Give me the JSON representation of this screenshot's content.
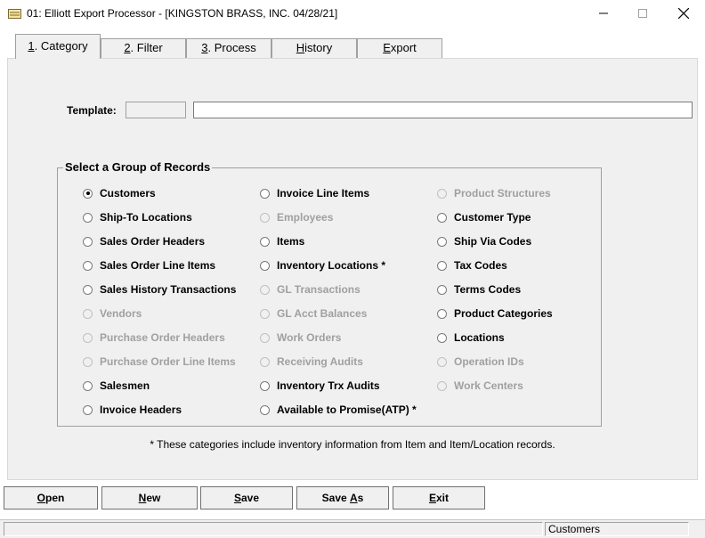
{
  "window": {
    "title": "01: Elliott Export Processor - [KINGSTON BRASS, INC. 04/28/21]",
    "icon": "folder-icon"
  },
  "tabs": [
    {
      "mnemonic": "1",
      "rest": ". Category",
      "active": true
    },
    {
      "mnemonic": "2",
      "rest": ". Filter",
      "active": false
    },
    {
      "mnemonic": "3",
      "rest": ". Process",
      "active": false
    },
    {
      "mnemonic": "H",
      "rest": "istory",
      "active": false
    },
    {
      "mnemonic": "E",
      "rest": "xport",
      "active": false
    }
  ],
  "template": {
    "label": "Template:",
    "code_value": "",
    "description_value": ""
  },
  "group": {
    "title": "Select a Group of Records",
    "col1": [
      {
        "label": "Customers",
        "enabled": true,
        "checked": true
      },
      {
        "label": "Ship-To Locations",
        "enabled": true,
        "checked": false
      },
      {
        "label": "Sales Order Headers",
        "enabled": true,
        "checked": false
      },
      {
        "label": "Sales Order Line Items",
        "enabled": true,
        "checked": false
      },
      {
        "label": "Sales History Transactions",
        "enabled": true,
        "checked": false
      },
      {
        "label": "Vendors",
        "enabled": false,
        "checked": false
      },
      {
        "label": "Purchase Order Headers",
        "enabled": false,
        "checked": false
      },
      {
        "label": "Purchase Order Line Items",
        "enabled": false,
        "checked": false
      },
      {
        "label": "Salesmen",
        "enabled": true,
        "checked": false
      },
      {
        "label": "Invoice Headers",
        "enabled": true,
        "checked": false
      }
    ],
    "col2": [
      {
        "label": "Invoice Line Items",
        "enabled": true,
        "checked": false
      },
      {
        "label": "Employees",
        "enabled": false,
        "checked": false
      },
      {
        "label": "Items",
        "enabled": true,
        "checked": false
      },
      {
        "label": "Inventory Locations *",
        "enabled": true,
        "checked": false
      },
      {
        "label": "GL Transactions",
        "enabled": false,
        "checked": false
      },
      {
        "label": "GL Acct Balances",
        "enabled": false,
        "checked": false
      },
      {
        "label": "Work Orders",
        "enabled": false,
        "checked": false
      },
      {
        "label": "Receiving Audits",
        "enabled": false,
        "checked": false
      },
      {
        "label": "Inventory Trx Audits",
        "enabled": true,
        "checked": false
      },
      {
        "label": "Available to Promise(ATP) *",
        "enabled": true,
        "checked": false
      }
    ],
    "col3": [
      {
        "label": "Product Structures",
        "enabled": false,
        "checked": false
      },
      {
        "label": "Customer Type",
        "enabled": true,
        "checked": false
      },
      {
        "label": "Ship Via Codes",
        "enabled": true,
        "checked": false
      },
      {
        "label": "Tax Codes",
        "enabled": true,
        "checked": false
      },
      {
        "label": "Terms Codes",
        "enabled": true,
        "checked": false
      },
      {
        "label": "Product Categories",
        "enabled": true,
        "checked": false
      },
      {
        "label": "Locations",
        "enabled": true,
        "checked": false
      },
      {
        "label": "Operation IDs",
        "enabled": false,
        "checked": false
      },
      {
        "label": "Work Centers",
        "enabled": false,
        "checked": false
      }
    ]
  },
  "footnote": "* These categories include inventory information from Item and Item/Location records.",
  "buttons": [
    {
      "mnemonic": "O",
      "rest": "pen",
      "pre": ""
    },
    {
      "mnemonic": "N",
      "rest": "ew",
      "pre": ""
    },
    {
      "mnemonic": "S",
      "rest": "ave",
      "pre": ""
    },
    {
      "mnemonic": "A",
      "rest": "s",
      "pre": "Save "
    },
    {
      "mnemonic": "E",
      "rest": "xit",
      "pre": ""
    }
  ],
  "status": {
    "selected_group": "Customers"
  },
  "colors": {
    "panel": "#f0f0f0",
    "disabled_text": "#a0a0a0"
  }
}
